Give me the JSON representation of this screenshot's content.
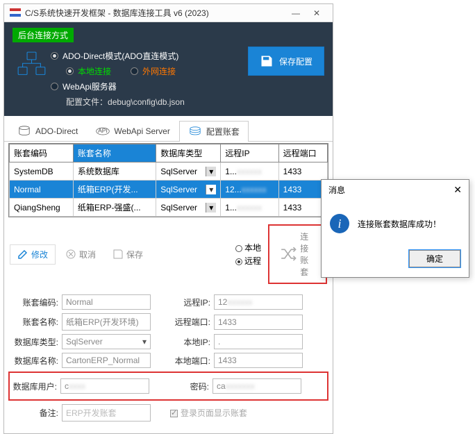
{
  "window": {
    "title": "C/S系统快速开发框架 - 数据库连接工具 v6 (2023)",
    "minimize": "—",
    "close": "✕"
  },
  "header": {
    "badge": "后台连接方式",
    "ado_direct": "ADO-Direct模式(ADO直连模式)",
    "local_conn": "本地连接",
    "remote_conn": "外网连接",
    "webapi": "WebApi服务器",
    "config_label": "配置文件：",
    "config_path": "debug\\config\\db.json",
    "save_config": "保存配置"
  },
  "tabs": {
    "ado": "ADO-Direct",
    "webapi": "WebApi Server",
    "accts": "配置账套"
  },
  "grid": {
    "headers": {
      "code": "账套编码",
      "name": "账套名称",
      "dbtype": "数据库类型",
      "ip": "远程IP",
      "port": "远程端口"
    },
    "rows": [
      {
        "code": "SystemDB",
        "name": "系统数据库",
        "dbtype": "SqlServer",
        "ip": "1...",
        "port": "1433"
      },
      {
        "code": "Normal",
        "name": "纸箱ERP(开发...",
        "dbtype": "SqlServer",
        "ip": "12...",
        "port": "1433"
      },
      {
        "code": "QiangSheng",
        "name": "纸箱ERP-强盛(...",
        "dbtype": "SqlServer",
        "ip": "1...",
        "port": "1433"
      }
    ]
  },
  "toolbar": {
    "modify": "修改",
    "cancel": "取消",
    "save": "保存",
    "local": "本地",
    "remote": "远程",
    "connect": "连接账套"
  },
  "form": {
    "code_lbl": "账套编码:",
    "code_val": "Normal",
    "name_lbl": "账套名称:",
    "name_val": "纸箱ERP(开发环境)",
    "dbtype_lbl": "数据库类型:",
    "dbtype_val": "SqlServer",
    "dbname_lbl": "数据库名称:",
    "dbname_val": "CartonERP_Normal",
    "dbuser_lbl": "数据库用户:",
    "dbuser_val": "c",
    "note_lbl": "备注:",
    "note_val": "ERP开发账套",
    "rip_lbl": "远程IP:",
    "rip_val": "12",
    "rport_lbl": "远程端口:",
    "rport_val": "1433",
    "lip_lbl": "本地IP:",
    "lip_val": ".",
    "lport_lbl": "本地端口:",
    "lport_val": "1433",
    "pwd_lbl": "密码:",
    "pwd_val": "ca",
    "show_lbl": "登录页面显示账套"
  },
  "dialog": {
    "title": "消息",
    "message": "连接账套数据库成功！",
    "ok": "确定"
  }
}
